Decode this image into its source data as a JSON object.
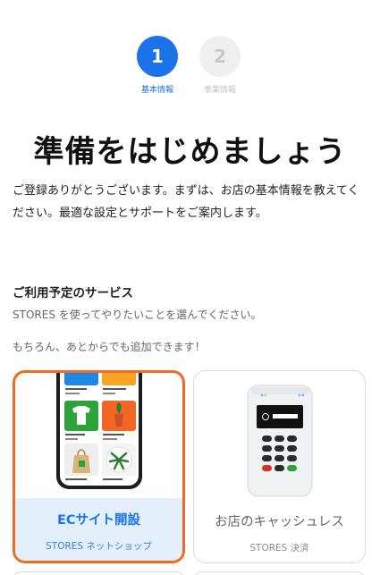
{
  "stepper": {
    "steps": [
      {
        "number": "1",
        "label": "基本情報"
      },
      {
        "number": "2",
        "label": "事業情報"
      }
    ]
  },
  "page": {
    "title": "準備をはじめましょう",
    "intro": "ご登録ありがとうございます。まずは、お店の基本情報を教えてください。最適な設定とサポートをご案内します。"
  },
  "services": {
    "title": "ご利用予定のサービス",
    "subtitle": "STORES を使ってやりたいことを選んでください。",
    "note": "もちろん、あとからでも追加できます！",
    "cards": [
      {
        "name": "ECサイト開設",
        "brand": "STORES ネットショップ",
        "selected": true
      },
      {
        "name": "お店のキャッシュレス",
        "brand": "STORES 決済",
        "selected": false
      }
    ]
  },
  "colors": {
    "primary": "#1a73e8",
    "selected_border": "#f06a22",
    "selected_bg": "#e4effc"
  }
}
